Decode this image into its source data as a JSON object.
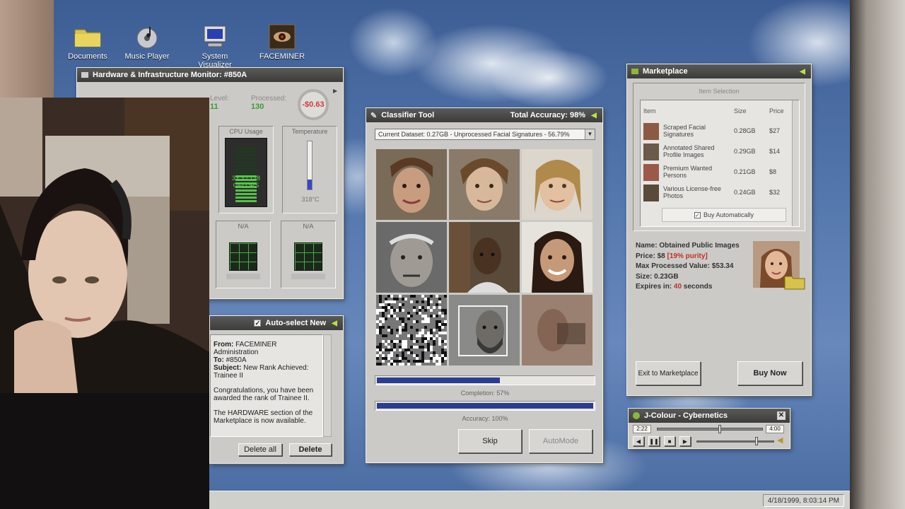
{
  "desktop_icons": [
    {
      "label": "Documents",
      "icon": "folder-icon"
    },
    {
      "label": "Music Player",
      "icon": "cd-icon"
    },
    {
      "label": "System Visualizer",
      "icon": "monitor-icon"
    },
    {
      "label": "FACEMINER",
      "icon": "eye-icon"
    }
  ],
  "hardware": {
    "title": "Hardware & Infrastructure Monitor: #850A",
    "level_label": "Level:",
    "level_value": "11",
    "processed_label": "Processed:",
    "processed_value": "130",
    "balance": "-$0.63",
    "cpu_label": "CPU Usage",
    "cpu_value": "33.3 / 128",
    "cpu_unit": "GFLOPS",
    "cpu_fraction": 0.26,
    "temp_label": "Temperature",
    "temp_value": "318°C",
    "temp_fraction": 0.2,
    "slot_a_label": "N/A",
    "slot_b_label": "N/A"
  },
  "mail": {
    "auto_select_label": "Auto-select New",
    "auto_select_checked": true,
    "from_label": "From:",
    "from_value": "FACEMINER Administration",
    "to_label": "To:",
    "to_value": "#850A",
    "subject_label": "Subject:",
    "subject_value": "New Rank Achieved: Trainee II",
    "body_1": "Congratulations, you have been awarded the rank of Trainee II.",
    "body_2": "The HARDWARE section of the Marketplace is now available.",
    "delete_all": "Delete all",
    "delete": "Delete"
  },
  "classifier": {
    "title": "Classifier Tool",
    "total_accuracy": "Total Accuracy: 98%",
    "dataset": "Current Dataset: 0.27GB - Unprocessed Facial Signatures - 56.79%",
    "completion_label": "Completion: 57%",
    "completion_fraction": 0.57,
    "accuracy_label": "Accuracy: 100%",
    "accuracy_fraction": 1.0,
    "skip": "Skip",
    "automode": "AutoMode"
  },
  "marketplace": {
    "title": "Marketplace",
    "section_label": "Item Selection",
    "columns": [
      "Item",
      "Size",
      "Price"
    ],
    "items": [
      {
        "name": "Scraped Facial Signatures",
        "size": "0.28GB",
        "price": "$27"
      },
      {
        "name": "Annotated Shared Profile Images",
        "size": "0.29GB",
        "price": "$14"
      },
      {
        "name": "Premium Wanted Persons",
        "size": "0.21GB",
        "price": "$8"
      },
      {
        "name": "Various License-free Photos",
        "size": "0.24GB",
        "price": "$32"
      }
    ],
    "buy_auto_label": "Buy Automatically",
    "buy_auto_checked": true,
    "detail_name": "Name: Obtained Public Images",
    "detail_price_prefix": "Price: $8 ",
    "detail_purity": "[19% purity]",
    "detail_max_value": "Max Processed Value: $53.34",
    "detail_size": "Size: 0.23GB",
    "detail_expires_prefix": "Expires in: ",
    "detail_expires_value": "40",
    "detail_expires_suffix": " seconds",
    "exit_button": "Exit to Marketplace",
    "buy_button": "Buy Now"
  },
  "player": {
    "title": "J-Colour - Cybernetics",
    "elapsed": "2:22",
    "total": "4:00",
    "position_fraction": 0.59,
    "volume_fraction": 0.78
  },
  "taskbar": {
    "clock": "4/18/1999, 8:03:14 PM"
  },
  "colors": {
    "accent_green": "#b8e04a",
    "progress_blue": "#2b3d8e",
    "alert_red": "#d43a3a"
  }
}
